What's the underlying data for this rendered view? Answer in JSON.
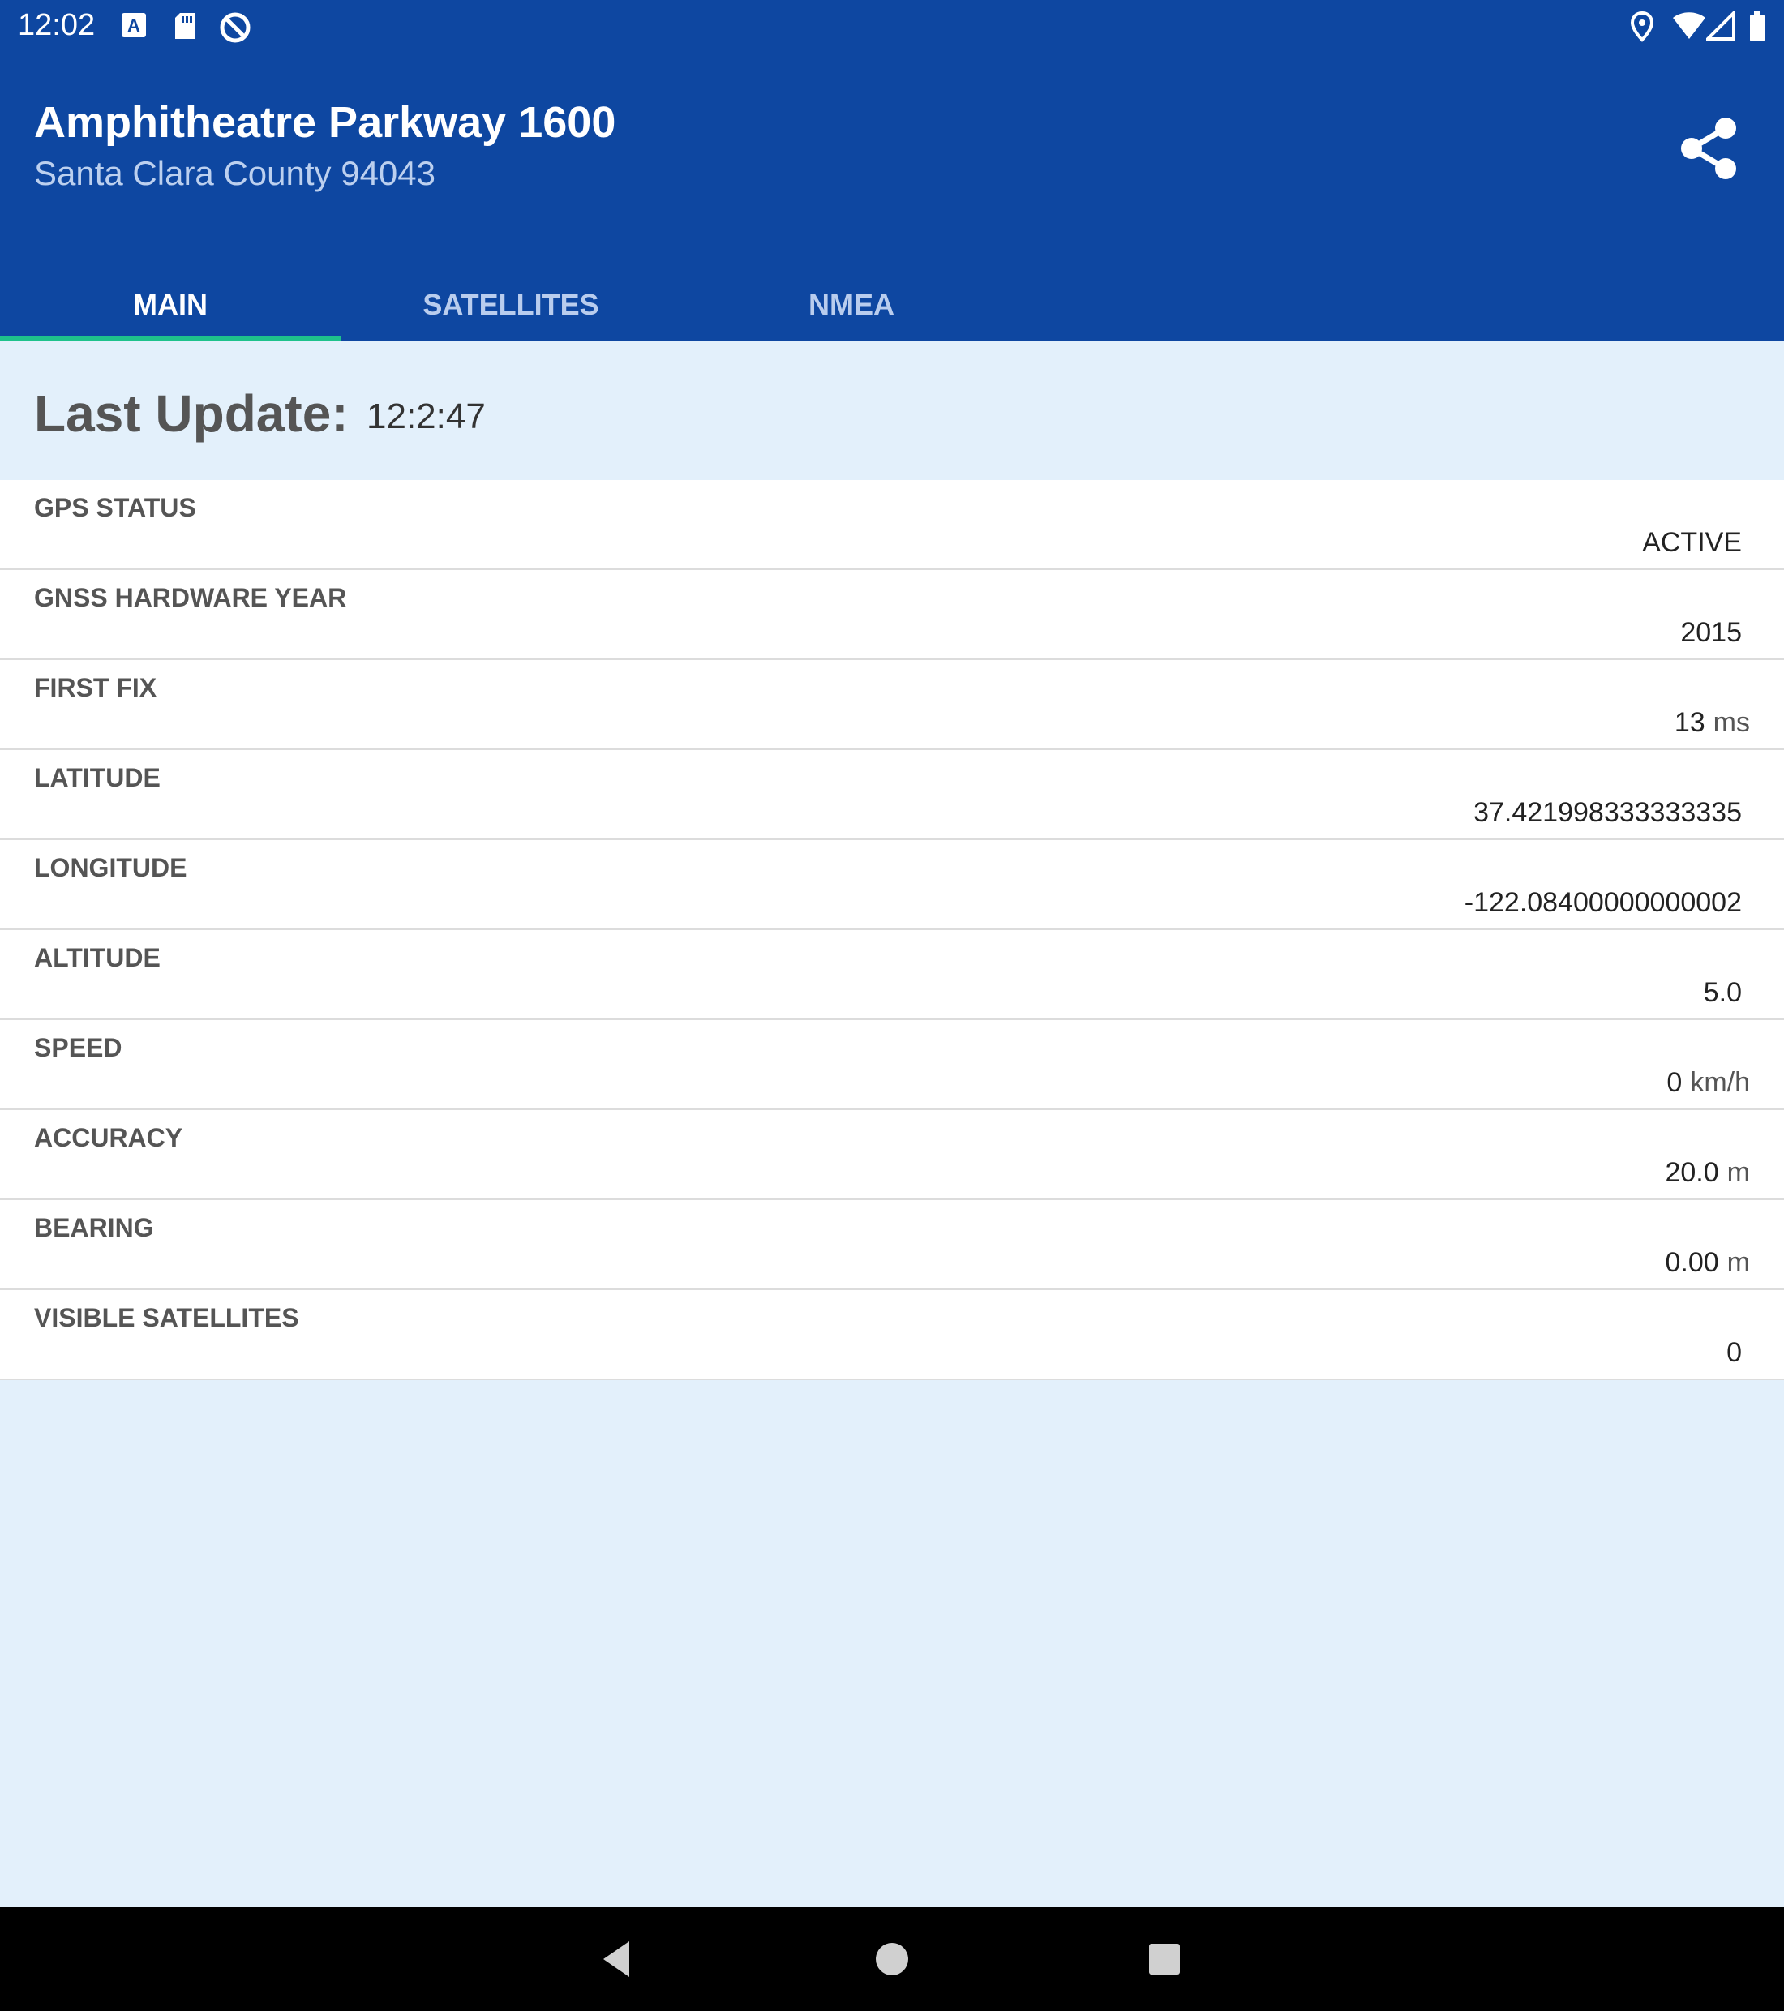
{
  "status_bar": {
    "time": "12:02",
    "left_icons": [
      "keyboard-a-icon",
      "sd-card-icon",
      "no-data-saver-icon"
    ],
    "right_icons": [
      "location-pin-icon",
      "wifi-icon",
      "signal-icon",
      "battery-icon"
    ]
  },
  "app_bar": {
    "title": "Amphitheatre Parkway 1600",
    "subtitle": "Santa Clara County 94043",
    "share_icon": "share-icon",
    "background_color": "#0e47a1"
  },
  "tabs": [
    {
      "label": "MAIN",
      "active": true
    },
    {
      "label": "SATELLITES",
      "active": false
    },
    {
      "label": "NMEA",
      "active": false
    }
  ],
  "accent_color": "#1ec28b",
  "last_update": {
    "label": "Last Update:",
    "value": "12:2:47"
  },
  "rows": [
    {
      "label": "GPS STATUS",
      "value": "ACTIVE",
      "unit": ""
    },
    {
      "label": "GNSS HARDWARE YEAR",
      "value": "2015",
      "unit": ""
    },
    {
      "label": "FIRST FIX",
      "value": "13",
      "unit": "ms"
    },
    {
      "label": "LATITUDE",
      "value": "37.421998333333335",
      "unit": ""
    },
    {
      "label": "LONGITUDE",
      "value": "-122.08400000000002",
      "unit": ""
    },
    {
      "label": "ALTITUDE",
      "value": "5.0",
      "unit": ""
    },
    {
      "label": "SPEED",
      "value": "0",
      "unit": "km/h"
    },
    {
      "label": "ACCURACY",
      "value": "20.0",
      "unit": "m"
    },
    {
      "label": "BEARING",
      "value": "0.00",
      "unit": "m"
    },
    {
      "label": "VISIBLE SATELLITES",
      "value": "0",
      "unit": ""
    }
  ],
  "nav_bar": {
    "icons": [
      "back-icon",
      "home-icon",
      "recents-icon"
    ]
  }
}
